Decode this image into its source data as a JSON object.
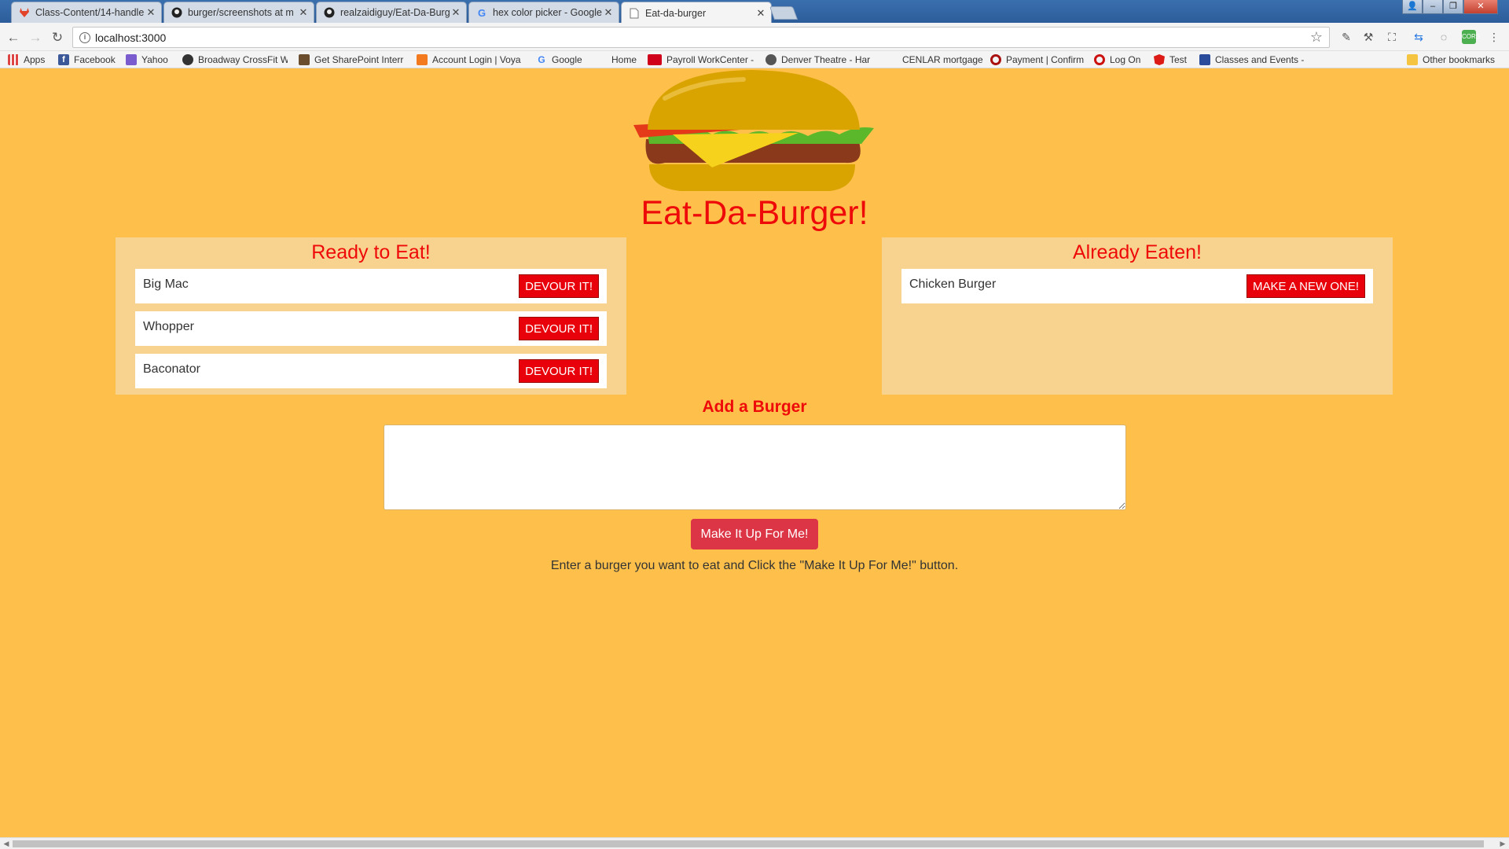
{
  "browser": {
    "tabs": [
      {
        "label": "Class-Content/14-handle",
        "icon": "gitlab-icon",
        "active": false
      },
      {
        "label": "burger/screenshots at m",
        "icon": "github-icon",
        "active": false
      },
      {
        "label": "realzaidiguy/Eat-Da-Burg",
        "icon": "github-icon",
        "active": false
      },
      {
        "label": "hex color picker - Google",
        "icon": "google-icon",
        "active": false
      },
      {
        "label": "Eat-da-burger",
        "icon": "page-icon",
        "active": true
      }
    ],
    "url": "localhost:3000",
    "bookmarks": [
      {
        "label": "Apps",
        "icon": "apps-grid-icon"
      },
      {
        "label": "Facebook",
        "icon": "facebook-icon"
      },
      {
        "label": "Yahoo",
        "icon": "yahoo-icon"
      },
      {
        "label": "Broadway CrossFit W",
        "icon": "crossfit-icon"
      },
      {
        "label": "Get SharePoint Interr",
        "icon": "sharepoint-icon"
      },
      {
        "label": "Account Login | Voya",
        "icon": "voya-icon"
      },
      {
        "label": "Google",
        "icon": "google-icon"
      },
      {
        "label": "Home",
        "icon": "blank-icon"
      },
      {
        "label": "Payroll WorkCenter -",
        "icon": "adp-icon"
      },
      {
        "label": "Denver Theatre - Har",
        "icon": "theatre-icon"
      },
      {
        "label": "CENLAR mortgage",
        "icon": "blank-icon"
      },
      {
        "label": "Payment | Confirm",
        "icon": "payment-icon"
      },
      {
        "label": "Log On",
        "icon": "logon-icon"
      },
      {
        "label": "Test",
        "icon": "angular-icon"
      },
      {
        "label": "Classes and Events -",
        "icon": "classes-icon"
      },
      {
        "label": "Other bookmarks",
        "icon": "folder-icon"
      }
    ]
  },
  "app": {
    "title": "Eat-Da-Burger!",
    "ready": {
      "heading": "Ready to Eat!",
      "items": [
        {
          "name": "Big Mac",
          "button": "DEVOUR IT!"
        },
        {
          "name": "Whopper",
          "button": "DEVOUR IT!"
        },
        {
          "name": "Baconator",
          "button": "DEVOUR IT!"
        }
      ]
    },
    "eaten": {
      "heading": "Already Eaten!",
      "items": [
        {
          "name": "Chicken Burger",
          "button": "MAKE A NEW ONE!"
        }
      ]
    },
    "add": {
      "heading": "Add a Burger",
      "input_value": "",
      "button": "Make It Up For Me!",
      "instructions": "Enter a burger you want to eat and Click the \"Make It Up For Me!\" button."
    }
  },
  "colors": {
    "background": "#fec04b",
    "panel": "#f8d38f",
    "accent_red": "#ef0a0a",
    "button_red": "#e8000a",
    "submit_button": "#dc3545"
  }
}
